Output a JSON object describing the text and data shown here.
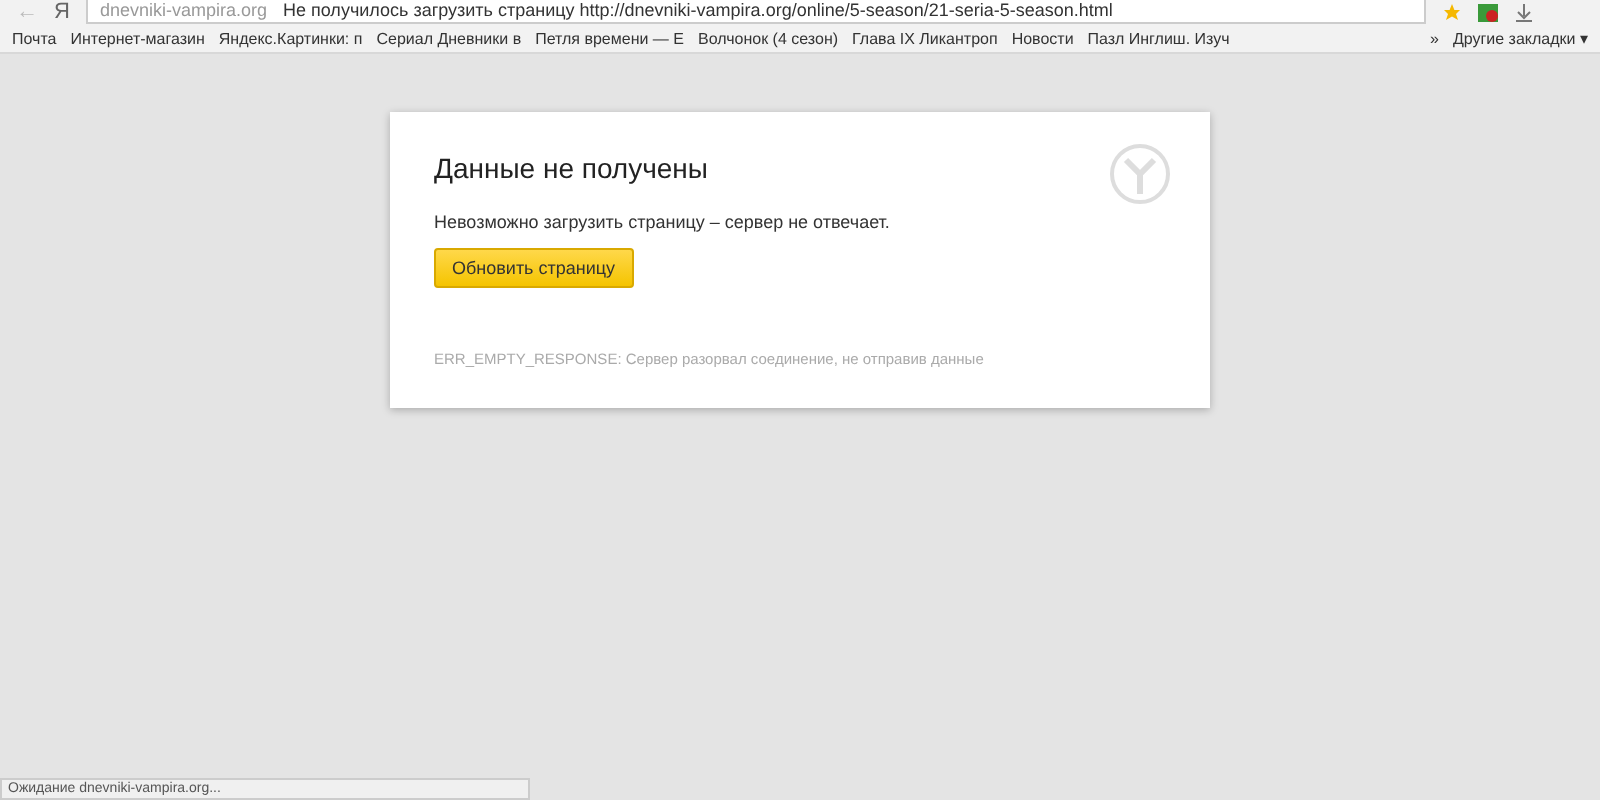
{
  "toolbar": {
    "back": "←",
    "logo": "Я",
    "domain": "dnevniki-vampira.org",
    "page_title": "Не получилось загрузить страницу http://dnevniki-vampira.org/online/5-season/21-seria-5-season.html"
  },
  "bookmarks": [
    "Почта",
    "Интернет-магазин",
    "Яндекс.Картинки: п",
    "Сериал Дневники в",
    "Петля времени — Е",
    "Волчонок (4 сезон)",
    "Глава IX Ликантроп",
    "Новости",
    "Пазл Инглиш. Изуч"
  ],
  "more": "»",
  "other_bookmarks": "Другие закладки ▾",
  "error": {
    "title": "Данные не получены",
    "message": "Невозможно загрузить страницу – сервер не отвечает.",
    "button": "Обновить страницу",
    "code": "ERR_EMPTY_RESPONSE: Сервер разорвал соединение, не отправив данные"
  },
  "status_bar": "Ожидание dnevniki-vampira.org..."
}
